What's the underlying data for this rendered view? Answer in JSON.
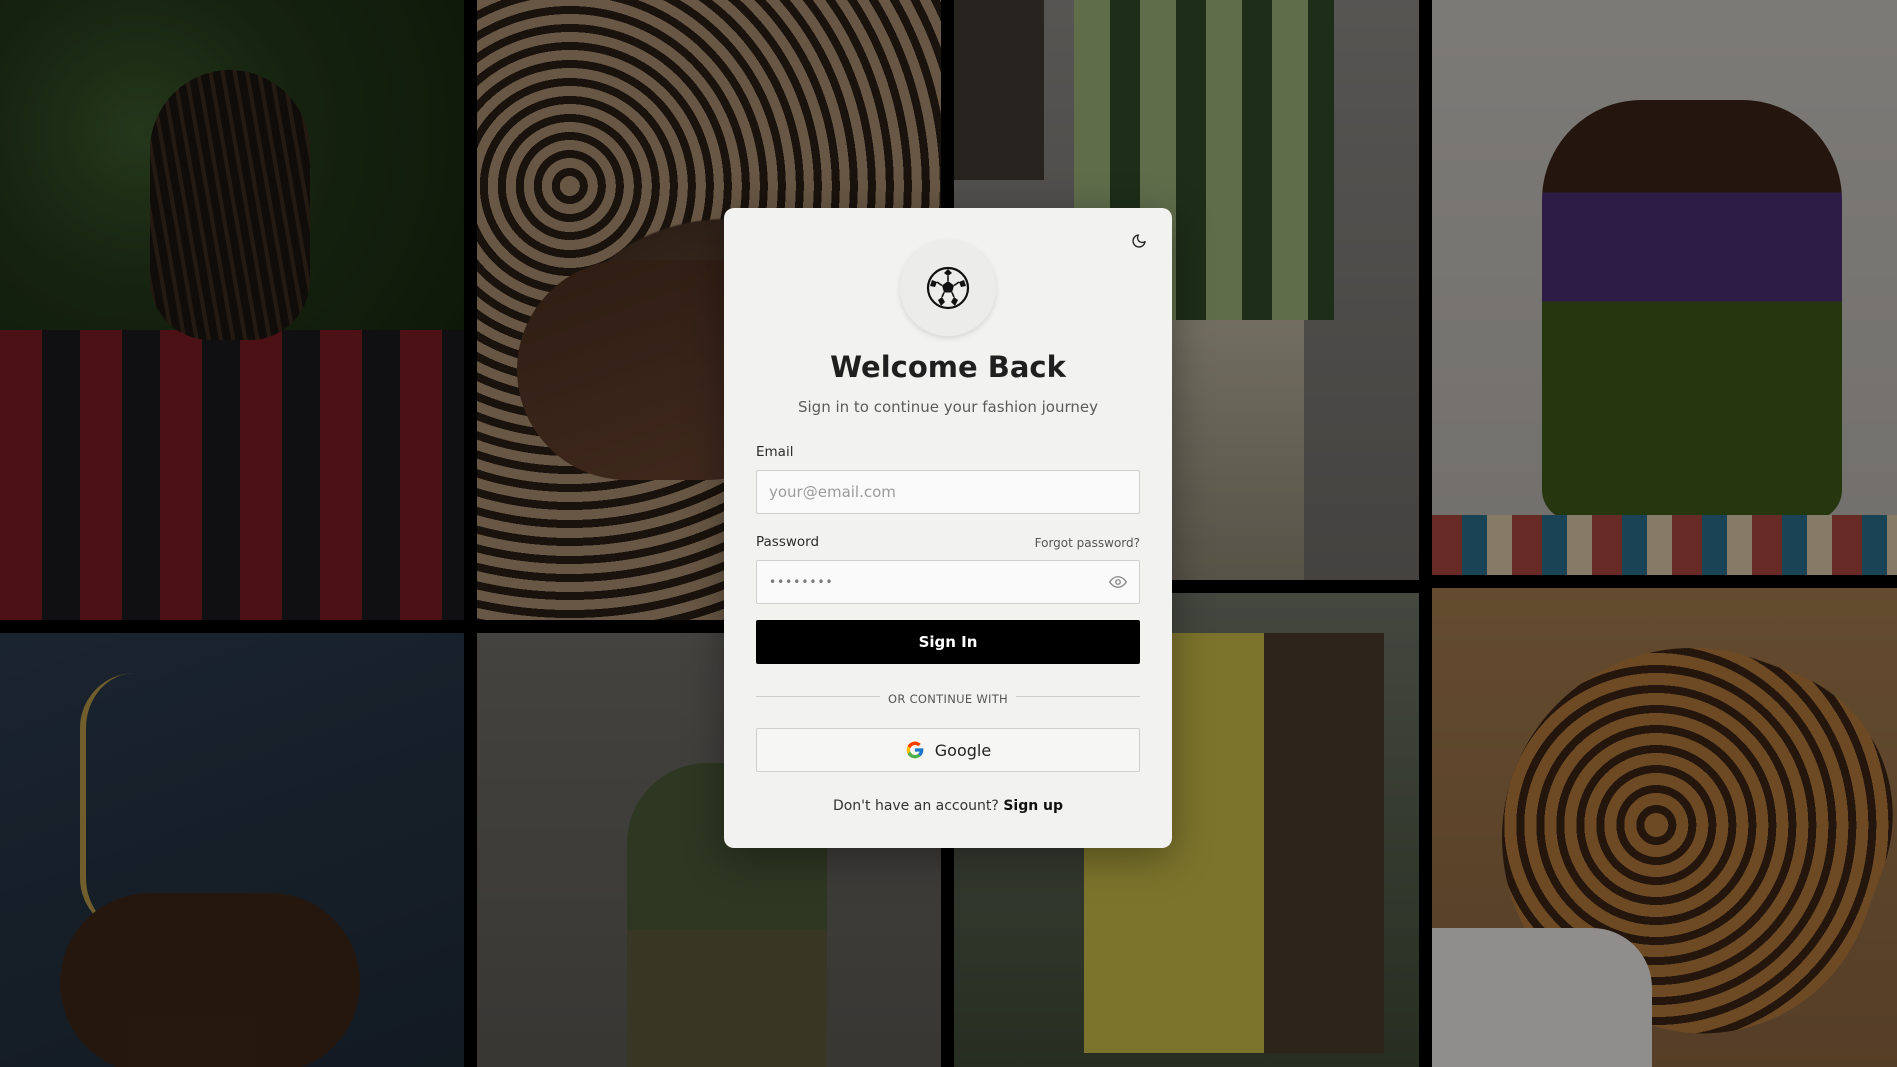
{
  "background": {
    "tiles": [
      "photo-1",
      "photo-2",
      "photo-3",
      "photo-4",
      "photo-5",
      "photo-6",
      "photo-7",
      "photo-8"
    ]
  },
  "card": {
    "theme_toggle_icon": "moon-icon",
    "logo_icon": "football-icon",
    "title": "Welcome Back",
    "subtitle": "Sign in to continue your fashion journey",
    "email": {
      "label": "Email",
      "placeholder": "your@email.com",
      "value": ""
    },
    "password": {
      "label": "Password",
      "value_masked": "••••••••",
      "forgot_label": "Forgot password?",
      "toggle_icon": "eye-icon"
    },
    "signin_label": "Sign In",
    "divider_label": "OR CONTINUE WITH",
    "google_label": "Google",
    "footer_prompt": "Don't have an account?",
    "signup_label": "Sign up"
  },
  "colors": {
    "primary_button": "#000000",
    "card_background": "#f2f2f1"
  }
}
